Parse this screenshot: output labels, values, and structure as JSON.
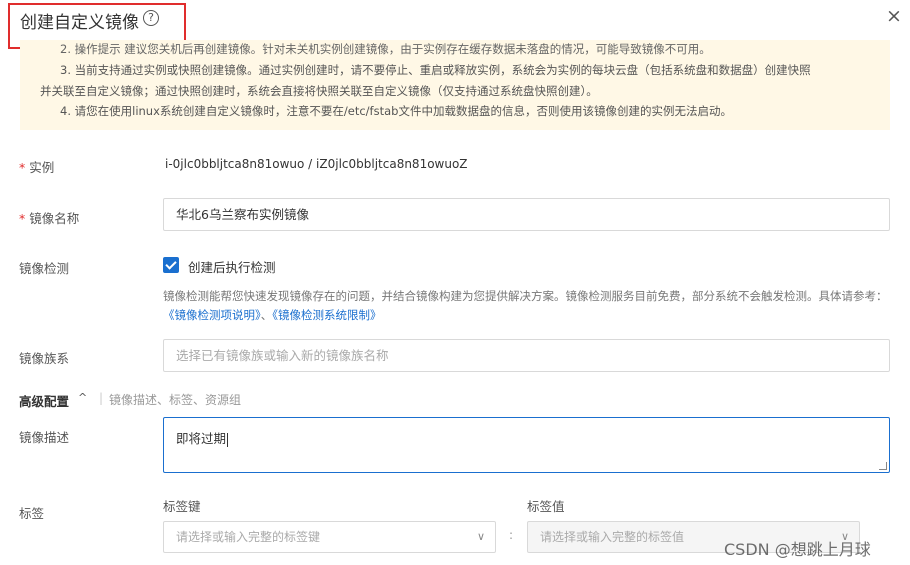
{
  "dialog": {
    "title": "创建自定义镜像",
    "help_icon": "?",
    "close_icon": "×"
  },
  "tips": {
    "line1": "2. 操作提示 建议您关机后再创建镜像。针对未关机实例创建镜像，由于实例存在缓存数据未落盘的情况，可能导致镜像不可用。",
    "line2": "3. 当前支持通过实例或快照创建镜像。通过实例创建时，请不要停止、重启或释放实例，系统会为实例的每块云盘（包括系统盘和数据盘）创建快照",
    "line3": "并关联至自定义镜像；通过快照创建时，系统会直接将快照关联至自定义镜像（仅支持通过系统盘快照创建）。",
    "line4": "4. 请您在使用linux系统创建自定义镜像时，注意不要在/etc/fstab文件中加载数据盘的信息，否则使用该镜像创建的实例无法启动。"
  },
  "form": {
    "instance_label": "实例",
    "instance_value": "i-0jlc0bbljtca8n81owuo / iZ0jlc0bbljtca8n81owuoZ",
    "image_name_label": "镜像名称",
    "image_name_value": "华北6乌兰察布实例镜像",
    "image_check_label": "镜像检测",
    "image_check_option": "创建后执行检测",
    "image_check_desc": "镜像检测能帮您快速发现镜像存在的问题，并结合镜像构建为您提供解决方案。镜像检测服务目前免费，部分系统不会触发检测。具体请参考：",
    "link1": "《镜像检测项说明》",
    "link_sep": "、",
    "link2": "《镜像检测系统限制》",
    "family_label": "镜像族系",
    "family_placeholder": "选择已有镜像族或输入新的镜像族名称",
    "advanced_label": "高级配置",
    "advanced_caret": "^",
    "advanced_sep": "|",
    "advanced_hint": "镜像描述、标签、资源组",
    "desc_label": "镜像描述",
    "desc_value": "即将过期",
    "tag_label": "标签",
    "tag_key_label": "标签键",
    "tag_value_label": "标签值",
    "tag_key_placeholder": "请选择或输入完整的标签键",
    "tag_value_placeholder": "请选择或输入完整的标签值",
    "colon": ":",
    "chevron": "∨"
  },
  "watermark": "CSDN @想跳上月球",
  "colors": {
    "accent": "#1a6fcf",
    "required": "#e02d2d",
    "tips_bg": "#fff8e6"
  }
}
